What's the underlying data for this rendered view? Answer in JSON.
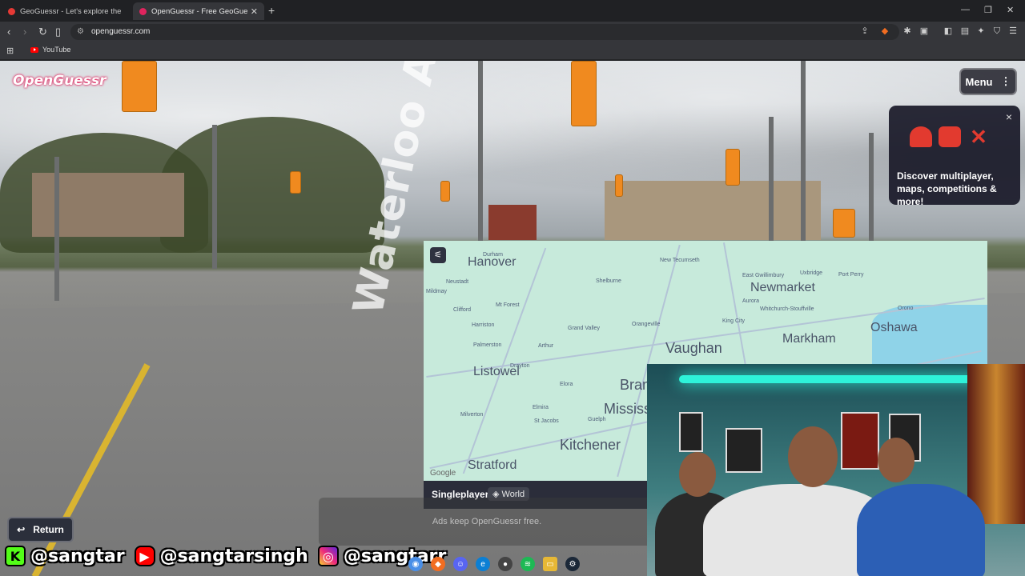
{
  "browser": {
    "tabs": [
      {
        "title": "GeoGuessr - Let's explore the world!",
        "active": false
      },
      {
        "title": "OpenGuessr - Free GeoGuessr",
        "active": true
      }
    ],
    "new_tab": "+",
    "url": "openguessr.com",
    "bookmarks": [
      {
        "label": "YouTube"
      }
    ]
  },
  "game": {
    "logo": "OpenGuessr",
    "menu_label": "Menu",
    "street_sign_text": "Waterloo Ave",
    "promo": {
      "text": "Discover multiplayer, maps, competitions & more!",
      "close": "×"
    },
    "return_label": "Return",
    "ad_text": "Ads keep OpenGuessr free.",
    "mode_label": "Singleplayer",
    "map_name": "World",
    "map": {
      "google": "Google",
      "cities": [
        "Hanover",
        "Newmarket",
        "Vaughan",
        "Markham",
        "Oshawa",
        "Listowel",
        "Kitchener",
        "Stratford",
        "Brampton",
        "Mississauga"
      ],
      "towns": [
        "Durham",
        "Neustadt",
        "Mildmay",
        "Clifford",
        "Mt Forest",
        "Shelburne",
        "New Tecumseth",
        "East Gwillimbury",
        "Uxbridge",
        "Port Perry",
        "Harriston",
        "Grand Valley",
        "Orangeville",
        "Aurora",
        "Whitchurch-Stouffville",
        "King City",
        "Orono",
        "Palmerston",
        "Arthur",
        "Drayton",
        "Elora",
        "Milverton",
        "Elmira",
        "St Jacobs",
        "Guelph"
      ]
    }
  },
  "stream": {
    "kick_handle": "@sangtar",
    "youtube_handle": "@sangtarsingh",
    "instagram_handle": "@sangtarr"
  },
  "colors": {
    "accent": "#e0245e",
    "map_land": "#c7eadb",
    "map_water": "#8fd3e8",
    "led": "#2ef2d9"
  }
}
